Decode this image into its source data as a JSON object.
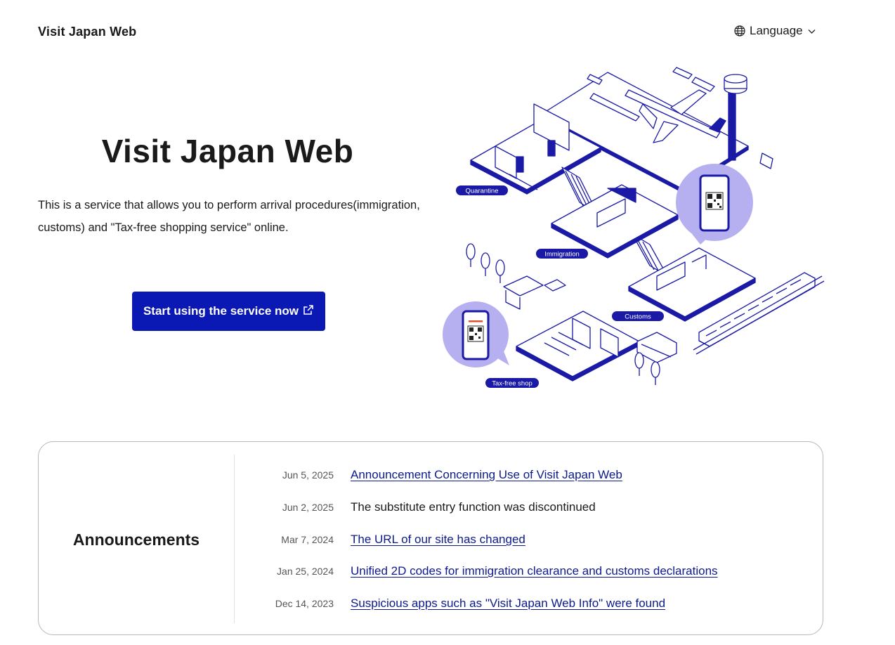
{
  "header": {
    "site_title": "Visit Japan Web",
    "language_label": "Language",
    "globe_icon": "globe-icon",
    "chevron_icon": "chevron-down-icon"
  },
  "hero": {
    "title": "Visit Japan Web",
    "description": "This is a service that allows you to perform arrival procedures(immigration, customs) and \"Tax-free shopping service\" online.",
    "cta_label": "Start using the service now",
    "cta_icon": "external-link-icon"
  },
  "illustration": {
    "labels": {
      "quarantine": "Quarantine",
      "immigration": "Immigration",
      "customs": "Customs",
      "taxfree": "Tax-free shop"
    }
  },
  "announcements": {
    "heading": "Announcements",
    "items": [
      {
        "date": "Jun 5, 2025",
        "title": "Announcement Concerning Use of Visit Japan Web",
        "link": true
      },
      {
        "date": "Jun 2, 2025",
        "title": "The substitute entry function was discontinued",
        "link": false
      },
      {
        "date": "Mar 7, 2024",
        "title": "The URL of our site has changed",
        "link": true
      },
      {
        "date": "Jan 25, 2024",
        "title": "Unified 2D codes for immigration clearance and customs declarations",
        "link": true
      },
      {
        "date": "Dec 14, 2023",
        "title": "Suspicious apps such as \"Visit Japan Web Info\" were found",
        "link": true
      }
    ]
  },
  "colors": {
    "brand_blue": "#0a18b4",
    "link_blue": "#0c1a8c",
    "illustration_navy": "#1a1aa6",
    "illustration_lavender": "#b7b0f0"
  }
}
